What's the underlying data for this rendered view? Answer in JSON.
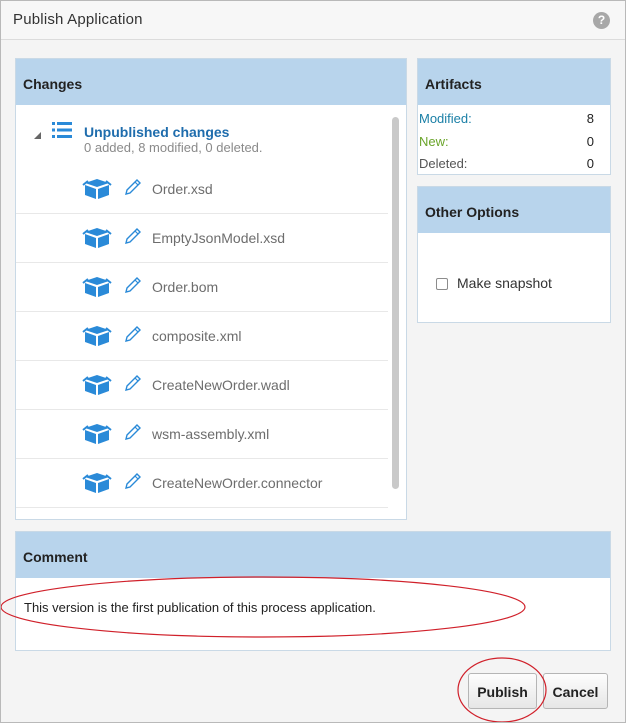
{
  "window": {
    "title": "Publish Application",
    "help_icon": "help-icon",
    "help_glyph": "?"
  },
  "changes": {
    "header": "Changes",
    "root": {
      "label": "Unpublished changes",
      "summary": "0 added, 8 modified, 0 deleted."
    },
    "files": [
      "Order.xsd",
      "EmptyJsonModel.xsd",
      "Order.bom",
      "composite.xml",
      "CreateNewOrder.wadl",
      "wsm-assembly.xml",
      "CreateNewOrder.connector"
    ]
  },
  "artifacts": {
    "header": "Artifacts",
    "rows": [
      {
        "label": "Modified:",
        "value": "8",
        "color": "#1a7fa6"
      },
      {
        "label": "New:",
        "value": "0",
        "color": "#6aa42a"
      },
      {
        "label": "Deleted:",
        "value": "0",
        "color": "#555555"
      }
    ]
  },
  "options": {
    "header": "Other Options",
    "snapshot_label": "Make snapshot",
    "snapshot_checked": false
  },
  "comment": {
    "header": "Comment",
    "text": "This version is the first publication of this process application."
  },
  "buttons": {
    "publish": "Publish",
    "cancel": "Cancel"
  },
  "colors": {
    "panel_header": "#b8d4ec",
    "link_blue": "#1f6dad",
    "annotation_red": "#d0202a",
    "icon_blue": "#2a8ad8"
  }
}
